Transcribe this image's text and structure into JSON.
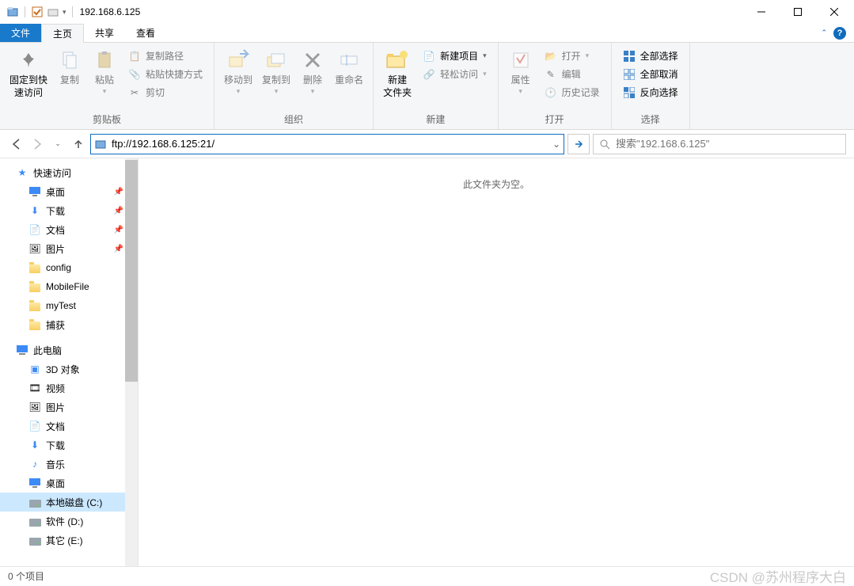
{
  "title": "192.168.6.125",
  "menutabs": {
    "file": "文件",
    "home": "主页",
    "share": "共享",
    "view": "查看"
  },
  "ribbon": {
    "pin": "固定到快\n速访问",
    "copy": "复制",
    "paste": "粘贴",
    "cut": "剪切",
    "copypath": "复制路径",
    "pasteshortcut": "粘贴快捷方式",
    "moveto": "移动到",
    "copyto": "复制到",
    "delete": "删除",
    "rename": "重命名",
    "newfolder": "新建\n文件夹",
    "newitem": "新建项目",
    "easyaccess": "轻松访问",
    "properties": "属性",
    "open": "打开",
    "edit": "编辑",
    "history": "历史记录",
    "selectall": "全部选择",
    "selectnone": "全部取消",
    "invertsel": "反向选择",
    "g_clipboard": "剪贴板",
    "g_organize": "组织",
    "g_new": "新建",
    "g_open": "打开",
    "g_select": "选择"
  },
  "nav": {
    "address": "ftp://192.168.6.125:21/",
    "search_placeholder": "搜索\"192.168.6.125\""
  },
  "sidebar": {
    "quick": "快速访问",
    "desktop": "桌面",
    "downloads": "下载",
    "documents": "文档",
    "pictures": "图片",
    "config": "config",
    "mobile": "MobileFile",
    "mytest": "myTest",
    "capture": "捕获",
    "thispc": "此电脑",
    "objects3d": "3D 对象",
    "video": "视频",
    "pictures2": "图片",
    "documents2": "文档",
    "downloads2": "下载",
    "music": "音乐",
    "desktop2": "桌面",
    "cdrive": "本地磁盘 (C:)",
    "ddrive": "软件 (D:)",
    "edrive": "其它 (E:)"
  },
  "main": {
    "empty": "此文件夹为空。"
  },
  "status": {
    "items": "0 个项目"
  },
  "watermark": "CSDN @苏州程序大白"
}
